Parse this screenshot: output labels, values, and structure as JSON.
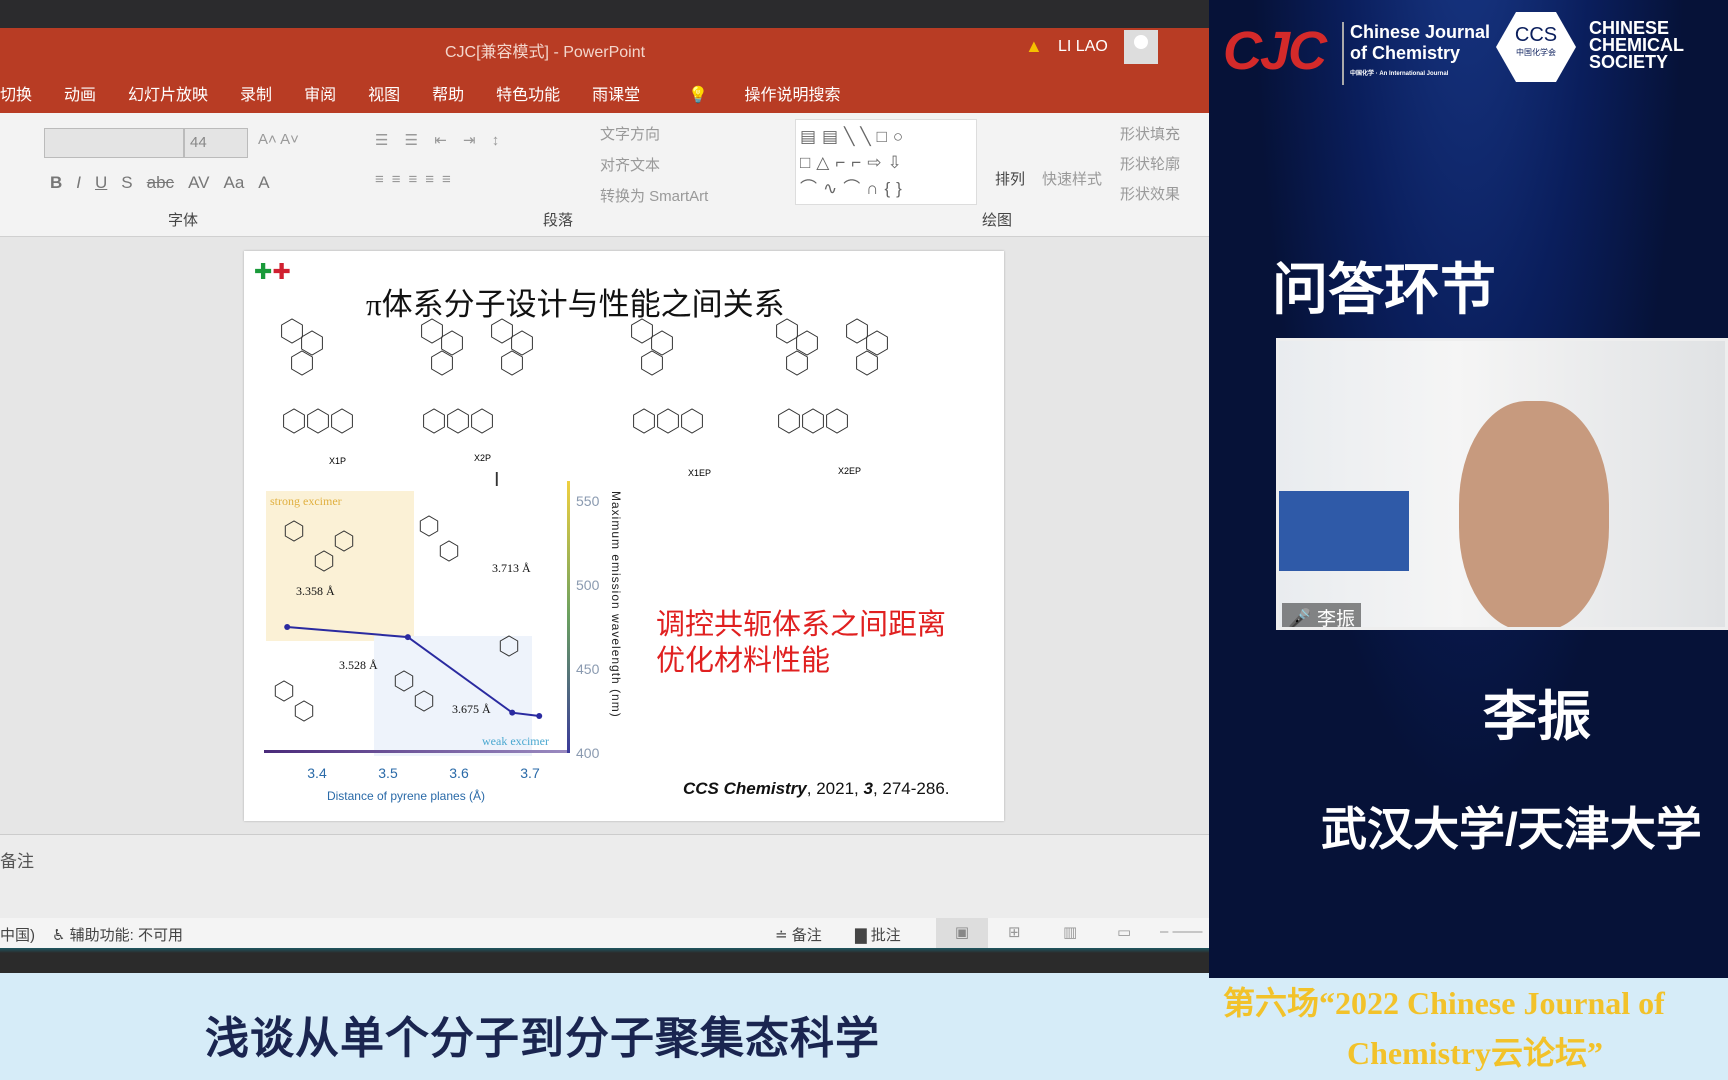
{
  "app": {
    "title": "CJC[兼容模式] - PowerPoint",
    "user": "LI LAO",
    "warning_icon": "warning-icon",
    "title_bar_color": "#b83c24"
  },
  "tabs": [
    "切换",
    "动画",
    "幻灯片放映",
    "录制",
    "审阅",
    "视图",
    "帮助",
    "特色功能",
    "雨课堂"
  ],
  "search_label": "操作说明搜索",
  "ribbon": {
    "font_size": "44",
    "groups": [
      "字体",
      "段落",
      "绘图"
    ],
    "font_buttons": [
      "B",
      "I",
      "U",
      "S",
      "abc",
      "AV",
      "Aa",
      "A"
    ],
    "para_items": [
      "文字方向",
      "对齐文本",
      "转换为 SmartArt"
    ],
    "arrange": "排列",
    "quick_styles": "快速样式",
    "shape_items": [
      "形状填充",
      "形状轮廓",
      "形状效果"
    ]
  },
  "slide": {
    "title_prefix": "π",
    "title": "体系分子设计与性能之间关系",
    "molecules": [
      "X1P",
      "X2P",
      "X1EP",
      "X2EP"
    ],
    "highlight": [
      "调控共轭体系之间距离",
      "优化材料性能"
    ],
    "citation": {
      "journal": "CCS Chemistry",
      "rest1": ", 2021, ",
      "volume": "3",
      "rest2": ", 274-286."
    },
    "annotations": {
      "strong": "strong excimer",
      "weak": "weak excimer",
      "d1": "3.358 Å",
      "d2": "3.528 Å",
      "d3": "3.675 Å",
      "d4": "3.713 Å"
    }
  },
  "chart_data": {
    "type": "line",
    "xlabel": "Distance of pyrene planes (Å)",
    "ylabel": "Maximum emission wavelength (nm)",
    "x_ticks": [
      "3.4",
      "3.5",
      "3.6",
      "3.7"
    ],
    "y_ticks": [
      "400",
      "450",
      "500",
      "550"
    ],
    "xlim": [
      3.33,
      3.75
    ],
    "ylim": [
      400,
      550
    ],
    "x": [
      3.358,
      3.528,
      3.675,
      3.713
    ],
    "y": [
      475,
      469,
      424,
      422
    ],
    "line_color": "#2a2aa0"
  },
  "notes_label": "备注",
  "status": {
    "lang": "中国)",
    "accessibility": "辅助功能: 不可用",
    "notes": "备注",
    "comments": "批注"
  },
  "caption": "浅谈从单个分子到分子聚集态科学",
  "panel": {
    "cjc": "CJC",
    "cjc_name1": "Chinese Journal",
    "cjc_name2": "of Chemistry",
    "cjc_sub": "中国化学 · An International Journal",
    "ccs": "CCS",
    "ccs_cn": "中国化学会",
    "ccs_name": [
      "CHINESE",
      "CHEMICAL",
      "SOCIETY"
    ],
    "section": "问答环节",
    "speaker_label": "李振",
    "speaker": "李振",
    "affiliation": "武汉大学/天津大学",
    "event_line1": "第六场“2022 Chinese Journal of",
    "event_line2": "Chemistry云论坛”"
  }
}
